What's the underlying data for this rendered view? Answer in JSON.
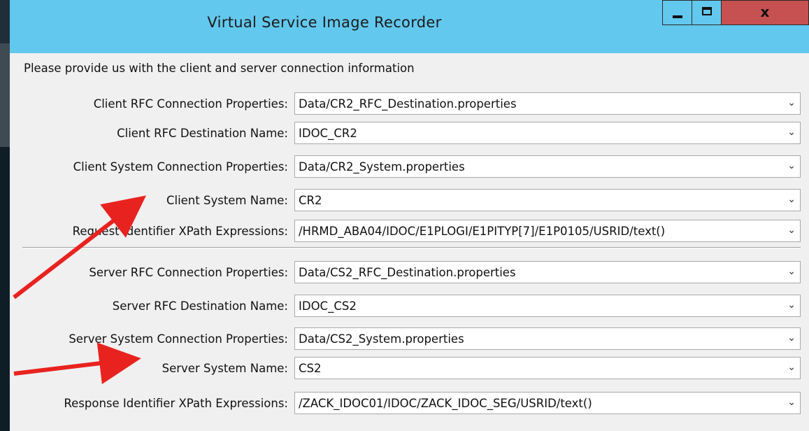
{
  "window": {
    "title": "Virtual Service Image Recorder",
    "controls": {
      "minimize": "minimize",
      "maximize": "maximize",
      "close": "x"
    },
    "titlebar_color": "#63c8ee",
    "close_color": "#c75050"
  },
  "form": {
    "instruction": "Please provide us with the client and server connection information",
    "client_fields": [
      {
        "label": "Client RFC Connection Properties:",
        "value": "Data/CR2_RFC_Destination.properties"
      },
      {
        "label": "Client RFC Destination Name:",
        "value": "IDOC_CR2"
      },
      {
        "label": "Client System Connection Properties:",
        "value": "Data/CR2_System.properties"
      },
      {
        "label": "Client System Name:",
        "value": "CR2"
      },
      {
        "label": "Request Identifier XPath Expressions:",
        "value": "/HRMD_ABA04/IDOC/E1PLOGI/E1PITYP[7]/E1P0105/USRID/text()"
      }
    ],
    "server_fields": [
      {
        "label": "Server RFC Connection Properties:",
        "value": "Data/CS2_RFC_Destination.properties"
      },
      {
        "label": "Server RFC Destination Name:",
        "value": "IDOC_CS2"
      },
      {
        "label": "Server System Connection Properties:",
        "value": "Data/CS2_System.properties"
      },
      {
        "label": "Server System Name:",
        "value": "CS2"
      },
      {
        "label": "Response Identifier XPath Expressions:",
        "value": "/ZACK_IDOC01/IDOC/ZACK_IDOC_SEG/USRID/text()"
      }
    ],
    "dropdown_icon": "chevron-down-icon"
  },
  "annotation": {
    "arrow_color": "#e8231f"
  }
}
